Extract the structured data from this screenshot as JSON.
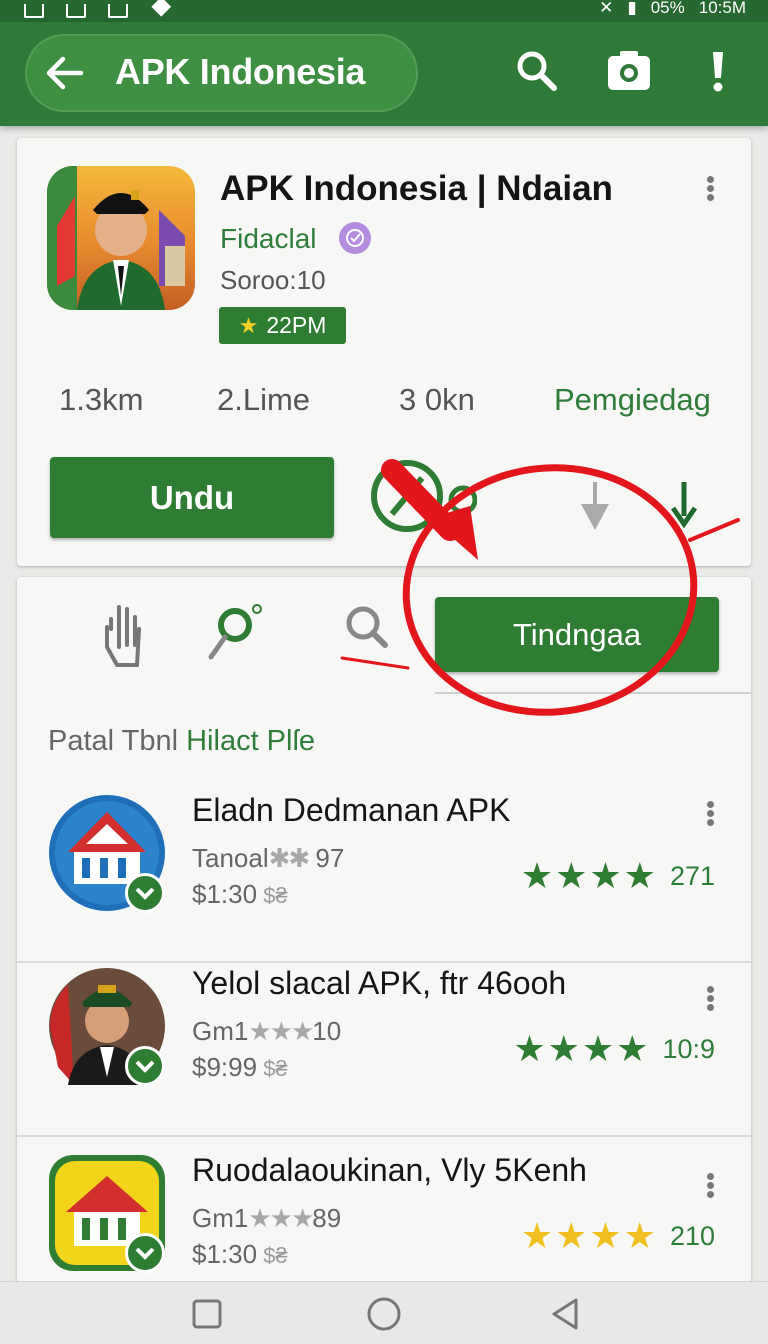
{
  "status_bar": {
    "battery_percent": "05%",
    "time": "10:5M"
  },
  "app_bar": {
    "title": "APK Indonesia",
    "back_icon": "arrow-left-icon",
    "actions": [
      "search-icon",
      "camera-icon",
      "exclamation-icon"
    ]
  },
  "app_header": {
    "name": "APK  Indonesia | Ndaian",
    "developer": "Fidaclal",
    "score": "Soroo:10",
    "rating_badge": "22PM",
    "stats": [
      "1.3km",
      "2.Lime",
      "3 0kn",
      "Pemgiedag"
    ],
    "install_label": "Undu"
  },
  "toolbar": {
    "primary_label": "Tindngaa",
    "icons": [
      "hand-icon",
      "pin-icon",
      "search-icon"
    ]
  },
  "section": {
    "title_plain": "Patal Tbnl ",
    "title_accent": "Hilact Plſe"
  },
  "list": [
    {
      "title": "Eladn Dedmanan  APK",
      "meta": "Tanoal",
      "meta_stars": "✱✱",
      "meta_num": " 97",
      "price": "$1:30",
      "price_suffix": " $₴",
      "stars": "★★★★",
      "rating_num": "271",
      "star_color": "#2e7d32"
    },
    {
      "title": "Yelol slacal APK, ftr 46ooh",
      "meta": "Gm1",
      "meta_stars": "★★★",
      "meta_num": "10",
      "price": "$9:99",
      "price_suffix": " $₴",
      "stars": "★★★★",
      "rating_num": "10:9",
      "star_color": "#2e7d32"
    },
    {
      "title": "Ruodalaoukinan, Vly 5Kenh",
      "meta": "Gm1",
      "meta_stars": "★★★",
      "meta_num": "89",
      "price": "$1:30",
      "price_suffix": " $₴",
      "stars": "★★★★",
      "rating_num": "210",
      "star_color": "#f1c020"
    }
  ],
  "annotation_color": "#e3161c",
  "brand_green": "#2e7d32"
}
